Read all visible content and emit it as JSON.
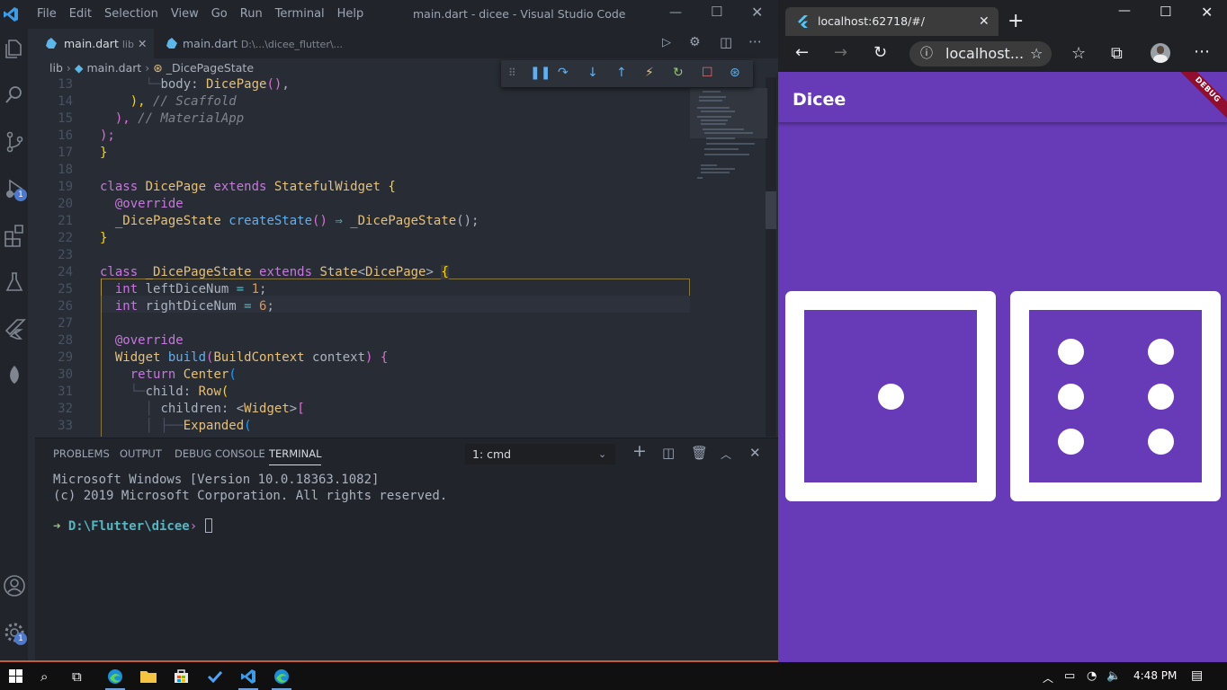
{
  "vscode": {
    "menu": [
      "File",
      "Edit",
      "Selection",
      "View",
      "Go",
      "Run",
      "Terminal",
      "Help"
    ],
    "title": "main.dart - dicee - Visual Studio Code",
    "tabs": [
      {
        "name": "main.dart",
        "hint": "lib"
      },
      {
        "name": "main.dart",
        "hint": "D:\\...\\dicee_flutter\\..."
      }
    ],
    "breadcrumb": {
      "folder": "lib",
      "file": "main.dart",
      "symbol": "_DicePageState"
    },
    "activity_badges": {
      "debug": "1",
      "settings": "1"
    },
    "line_numbers": [
      "13",
      "14",
      "15",
      "16",
      "17",
      "18",
      "19",
      "20",
      "21",
      "22",
      "23",
      "24",
      "25",
      "26",
      "27",
      "28",
      "29",
      "30",
      "31",
      "32",
      "33"
    ],
    "code": {
      "l13a": "body: ",
      "l13b": "DicePage",
      "l13c": "()",
      "l13d": ",",
      "l14a": "), ",
      "l14b": "// Scaffold",
      "l15a": "), ",
      "l15b": "// MaterialApp",
      "l16": ");",
      "l17": "}",
      "l19a": "class ",
      "l19b": "DicePage",
      "l19c": " extends ",
      "l19d": "StatefulWidget",
      "l19e": " {",
      "l20": "@override",
      "l21a": "_DicePageState",
      "l21b": " createState",
      "l21c": "() ",
      "l21d": "⇒",
      "l21e": " _DicePageState",
      "l21f": "();",
      "l22": "}",
      "l24a": "class ",
      "l24b": "_DicePageState",
      "l24c": " extends ",
      "l24d": "State",
      "l24e": "<",
      "l24f": "DicePage",
      "l24g": "> ",
      "l24h": "{",
      "l25a": "int",
      "l25b": " leftDiceNum ",
      "l25c": "=",
      "l25d": " 1",
      "l25e": ";",
      "l26a": "int",
      "l26b": " rightDiceNum ",
      "l26c": "=",
      "l26d": " 6",
      "l26e": ";",
      "l28": "@override",
      "l29a": "Widget",
      "l29b": " build",
      "l29c": "(",
      "l29d": "BuildContext",
      "l29e": " context",
      "l29f": ") ",
      "l29g": "{",
      "l30a": "return ",
      "l30b": "Center",
      "l30c": "(",
      "l31a": "child: ",
      "l31b": "Row",
      "l31c": "(",
      "l32a": "children: ",
      "l32b": "<",
      "l32c": "Widget",
      "l32d": ">",
      "l32e": "[",
      "l33a": "Expanded",
      "l33b": "("
    },
    "panel_tabs": [
      "PROBLEMS",
      "OUTPUT",
      "DEBUG CONSOLE",
      "TERMINAL"
    ],
    "terminal_select": "1: cmd",
    "terminal_lines": [
      "Microsoft Windows [Version 10.0.18363.1082]",
      "(c) 2019 Microsoft Corporation. All rights reserved."
    ],
    "prompt_path": "D:\\Flutter\\dicee"
  },
  "browser": {
    "tab_title": "localhost:62718/#/",
    "address": "localhost...",
    "app_title": "Dicee",
    "debug_banner": "DEBUG",
    "left_dice": 1,
    "right_dice": 6
  },
  "taskbar": {
    "time": "4:48 PM"
  }
}
